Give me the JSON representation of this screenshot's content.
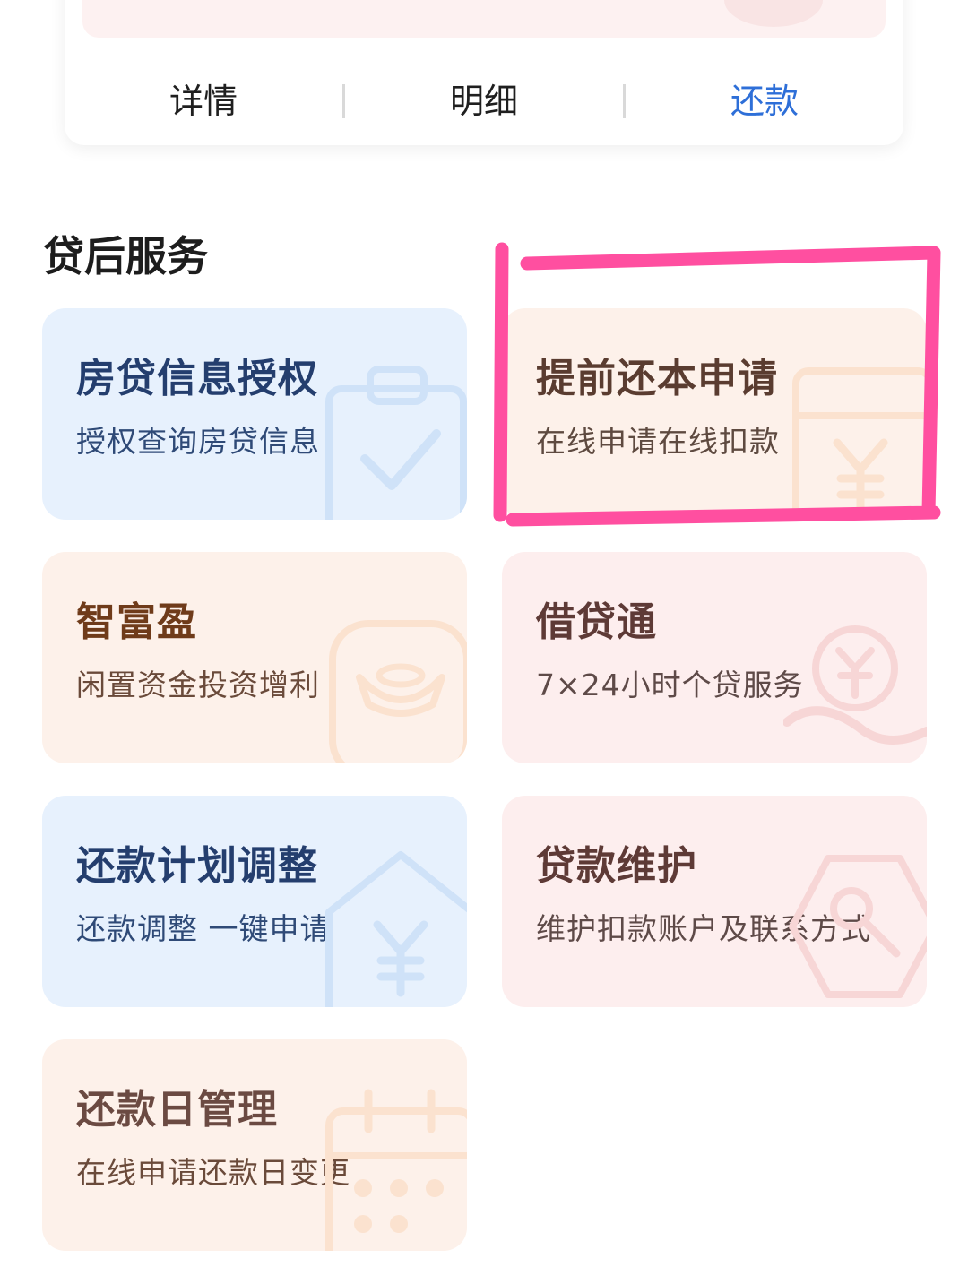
{
  "loan_card": {
    "actions": [
      {
        "label": "详情"
      },
      {
        "label": "明细"
      },
      {
        "label": "还款"
      }
    ],
    "accent_color": "#2e6fd8"
  },
  "section": {
    "title": "贷后服务"
  },
  "services": [
    {
      "title": "房贷信息授权",
      "subtitle": "授权查询房贷信息",
      "icon": "clipboard-check-icon"
    },
    {
      "title": "提前还本申请",
      "subtitle": "在线申请在线扣款",
      "icon": "calendar-yuan-icon"
    },
    {
      "title": "智富盈",
      "subtitle": "闲置资金投资增利",
      "icon": "gold-ingot-icon"
    },
    {
      "title": "借贷通",
      "subtitle": "7×24小时个贷服务",
      "icon": "hand-coin-icon"
    },
    {
      "title": "还款计划调整",
      "subtitle": "还款调整 一键申请",
      "icon": "house-yuan-icon"
    },
    {
      "title": "贷款维护",
      "subtitle": "维护扣款账户及联系方式",
      "icon": "hexagon-key-icon"
    },
    {
      "title": "还款日管理",
      "subtitle": "在线申请还款日变更",
      "icon": "calendar-icon"
    }
  ],
  "colors": {
    "highlight": "#ff4fa0",
    "blue_tile": "#e7f1fd",
    "peach_tile": "#fdf1ea",
    "pink_tile": "#fdeeee"
  }
}
